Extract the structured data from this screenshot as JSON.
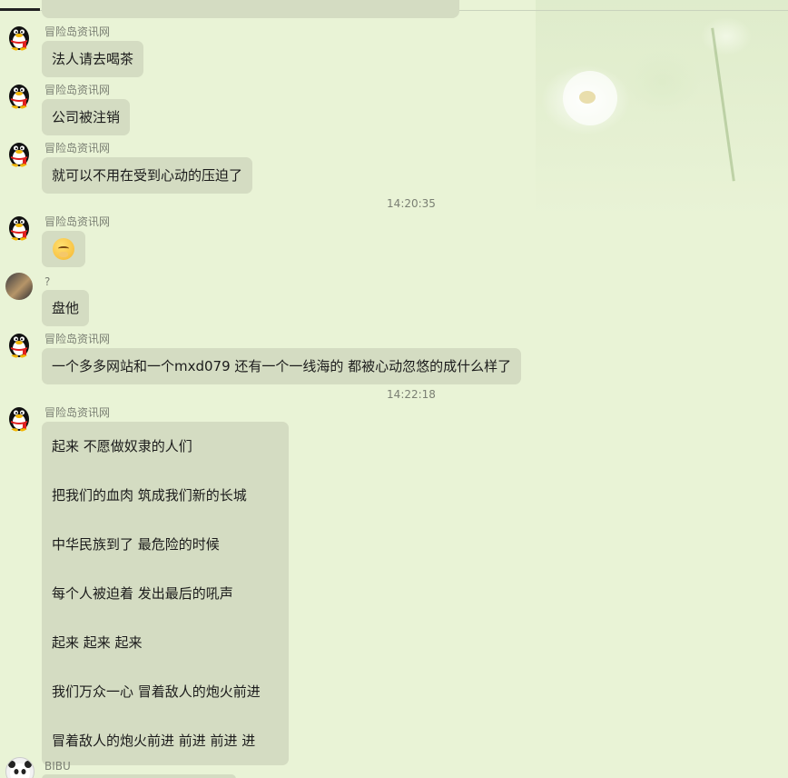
{
  "icons": {
    "qq_penguin": "qq-penguin-icon",
    "emoji": "worried-face-emoji"
  },
  "colors": {
    "background": "#e9f3d6",
    "bubble": "#d4dcc2",
    "sender": "#7a7f73"
  },
  "timestamps": [
    "14:20:35",
    "14:22:18"
  ],
  "messages": [
    {
      "sender": "冒险岛资讯网",
      "text": "法人请去喝茶"
    },
    {
      "sender": "冒险岛资讯网",
      "text": "公司被注销"
    },
    {
      "sender": "冒险岛资讯网",
      "text": "就可以不用在受到心动的压迫了"
    },
    {
      "sender": "冒险岛资讯网",
      "text": ""
    },
    {
      "sender": "?",
      "text": "盘他"
    },
    {
      "sender": "冒险岛资讯网",
      "text": "一个多多网站和一个mxd079 还有一个一线海的 都被心动忽悠的成什么样了"
    },
    {
      "sender": "冒险岛资讯网",
      "lines": [
        "起来  不愿做奴隶的人们",
        "把我们的血肉  筑成我们新的长城",
        "中华民族到了  最危险的时候",
        "每个人被迫着  发出最后的吼声",
        "起来  起来  起来",
        "我们万众一心  冒着敌人的炮火前进",
        "冒着敌人的炮火前进  前进 前进 进"
      ]
    },
    {
      "sender": "BIBU",
      "text": ""
    }
  ]
}
